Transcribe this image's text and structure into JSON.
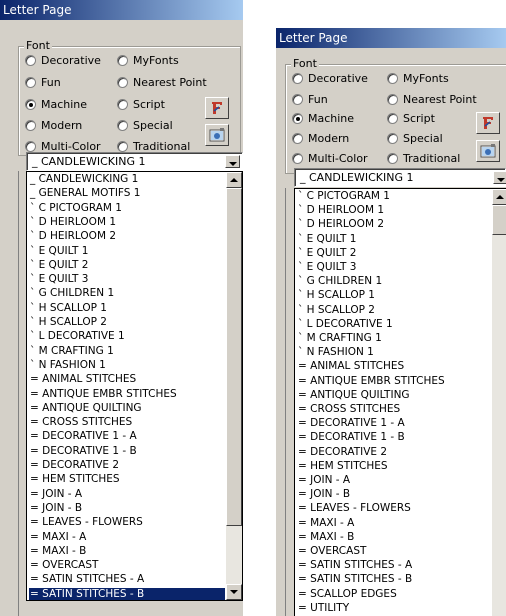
{
  "left": {
    "window_title": "Letter Page",
    "font_group_label": "Font",
    "radios": [
      {
        "label": "Decorative",
        "checked": false
      },
      {
        "label": "MyFonts",
        "checked": false
      },
      {
        "label": "Fun",
        "checked": false
      },
      {
        "label": "Nearest Point",
        "checked": false
      },
      {
        "label": "Machine",
        "checked": true
      },
      {
        "label": "Script",
        "checked": false
      },
      {
        "label": "Modern",
        "checked": false
      },
      {
        "label": "Special",
        "checked": false
      },
      {
        "label": "Multi-Color",
        "checked": false
      },
      {
        "label": "Traditional",
        "checked": false
      }
    ],
    "selected_font": "_ CANDLEWICKING 1",
    "list_items": [
      "_ CANDLEWICKING 1",
      "_ GENERAL MOTIFS 1",
      "` C PICTOGRAM 1",
      "` D HEIRLOOM 1",
      "` D HEIRLOOM 2",
      "` E QUILT 1",
      "` E QUILT 2",
      "` E QUILT 3",
      "` G CHILDREN 1",
      "` H SCALLOP 1",
      "` H SCALLOP 2",
      "` L DECORATIVE 1",
      "` M CRAFTING 1",
      "` N FASHION 1",
      "= ANIMAL STITCHES",
      "= ANTIQUE EMBR STITCHES",
      "= ANTIQUE QUILTING",
      "= CROSS STITCHES",
      "= DECORATIVE 1 - A",
      "= DECORATIVE 1 - B",
      "= DECORATIVE 2",
      "= HEM STITCHES",
      "= JOIN - A",
      "= JOIN - B",
      "= LEAVES - FLOWERS",
      "= MAXI - A",
      "= MAXI - B",
      "= OVERCAST",
      "= SATIN STITCHES - A",
      "= SATIN STITCHES - B"
    ],
    "highlighted_item": "= SATIN STITCHES - B"
  },
  "right": {
    "window_title": "Letter Page",
    "font_group_label": "Font",
    "radios": [
      {
        "label": "Decorative",
        "checked": false
      },
      {
        "label": "MyFonts",
        "checked": false
      },
      {
        "label": "Fun",
        "checked": false
      },
      {
        "label": "Nearest Point",
        "checked": false
      },
      {
        "label": "Machine",
        "checked": true
      },
      {
        "label": "Script",
        "checked": false
      },
      {
        "label": "Modern",
        "checked": false
      },
      {
        "label": "Special",
        "checked": false
      },
      {
        "label": "Multi-Color",
        "checked": false
      },
      {
        "label": "Traditional",
        "checked": false
      }
    ],
    "selected_font": "_ CANDLEWICKING 1",
    "list_items": [
      "` C PICTOGRAM 1",
      "` D HEIRLOOM 1",
      "` D HEIRLOOM 2",
      "` E QUILT 1",
      "` E QUILT 2",
      "` E QUILT 3",
      "` G CHILDREN 1",
      "` H SCALLOP 1",
      "` H SCALLOP 2",
      "` L DECORATIVE 1",
      "` M CRAFTING 1",
      "` N FASHION 1",
      "= ANIMAL STITCHES",
      "= ANTIQUE EMBR STITCHES",
      "= ANTIQUE QUILTING",
      "= CROSS STITCHES",
      "= DECORATIVE 1 - A",
      "= DECORATIVE 1 - B",
      "= DECORATIVE 2",
      "= HEM STITCHES",
      "= JOIN - A",
      "= JOIN - B",
      "= LEAVES - FLOWERS",
      "= MAXI - A",
      "= MAXI - B",
      "= OVERCAST",
      "= SATIN STITCHES - A",
      "= SATIN STITCHES - B",
      "= SCALLOP EDGES",
      "= UTILITY"
    ]
  },
  "colors": {
    "titlebar_start": "#0a246a",
    "titlebar_end": "#a6caf0",
    "face": "#d4d0c8",
    "selection": "#0a246a"
  }
}
